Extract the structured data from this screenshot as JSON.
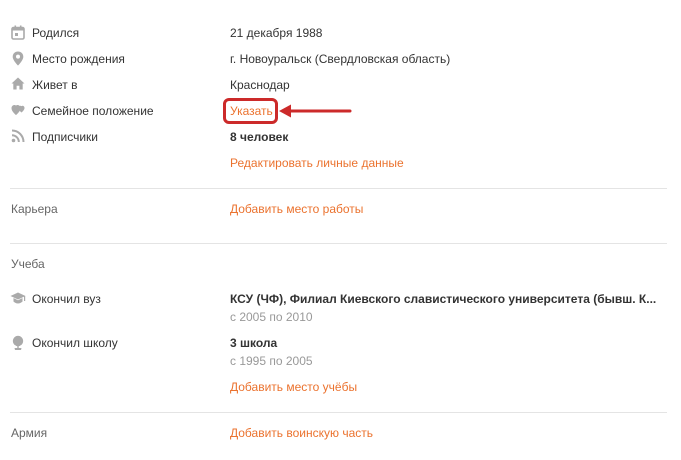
{
  "personal": {
    "born_label": "Родился",
    "born_value": "21 декабря 1988",
    "birthplace_label": "Место рождения",
    "birthplace_value": "г. Новоуральск (Свердловская область)",
    "lives_label": "Живет в",
    "lives_value": "Краснодар",
    "family_label": "Семейное положение",
    "family_link": "Указать",
    "subscribers_label": "Подписчики",
    "subscribers_value": "8 человек",
    "edit_link": "Редактировать личные данные"
  },
  "career": {
    "section_label": "Карьера",
    "add_link": "Добавить место работы"
  },
  "education": {
    "section_label": "Учеба",
    "university_label": "Окончил вуз",
    "university_name": "КСУ (ЧФ), Филиал Киевского славистического университета (бывш. К...",
    "university_years": "с 2005 по 2010",
    "school_label": "Окончил школу",
    "school_name": "3 школа",
    "school_years": "с 1995 по 2005",
    "add_link": "Добавить место учёбы"
  },
  "army": {
    "section_label": "Армия",
    "add_link": "Добавить воинскую часть"
  },
  "colors": {
    "accent": "#eb722e",
    "icon": "#aaaaaa",
    "annotation": "#cc2a2a"
  },
  "icons": [
    "calendar-icon",
    "location-pin-icon",
    "home-icon",
    "heart-icon",
    "rss-icon",
    "graduation-cap-icon",
    "globe-icon"
  ]
}
